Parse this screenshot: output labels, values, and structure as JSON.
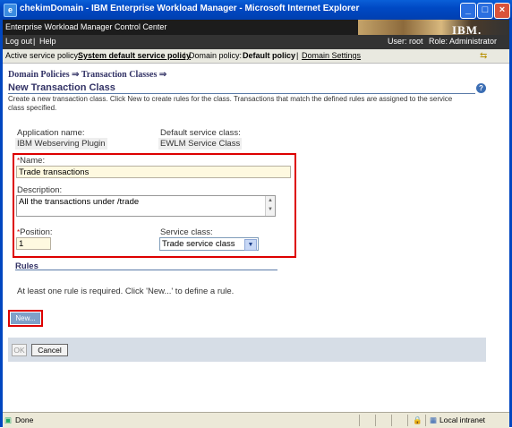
{
  "window": {
    "title": "chekimDomain - IBM Enterprise Workload Manager - Microsoft Internet Explorer",
    "min": "_",
    "max": "□",
    "close": "×"
  },
  "app": {
    "header": "Enterprise Workload Manager Control Center",
    "logo": "IBM."
  },
  "userbar": {
    "logout": "Log out",
    "sep": "|",
    "help": "Help",
    "user": "User: root",
    "role": "Role: Administrator"
  },
  "policybar": {
    "active_label": "Active service policy:",
    "active_value": "System default service policy",
    "sep1": "|",
    "domain_label": "Domain policy:",
    "domain_value": "Default policy",
    "sep2": "|",
    "settings_link": "Domain Settings"
  },
  "breadcrumb": {
    "item1": "Domain Policies ⇒",
    "item2": "Transaction Classes ⇒"
  },
  "page": {
    "title": "New Transaction Class",
    "help": "?",
    "description": "Create a new transaction class. Click New to create rules for the class. Transactions that match the defined rules are assigned to the service class specified."
  },
  "form": {
    "app_label": "Application name:",
    "app_value": "IBM Webserving Plugin",
    "default_sc_label": "Default service class:",
    "default_sc_value": "EWLM Service Class",
    "required_mark": "*",
    "name_label": "Name:",
    "name_value": "Trade transactions",
    "desc_label": "Description:",
    "desc_value": "All the transactions under /trade",
    "position_label": "Position:",
    "position_value": "1",
    "sc_label": "Service class:",
    "sc_value": "Trade service class"
  },
  "rules": {
    "heading": "Rules",
    "message": "At least one rule is required. Click 'New...' to define a rule.",
    "new_button": "New..."
  },
  "buttons": {
    "ok": "OK",
    "cancel": "Cancel"
  },
  "statusbar": {
    "status": "Done",
    "zone": "Local intranet"
  }
}
